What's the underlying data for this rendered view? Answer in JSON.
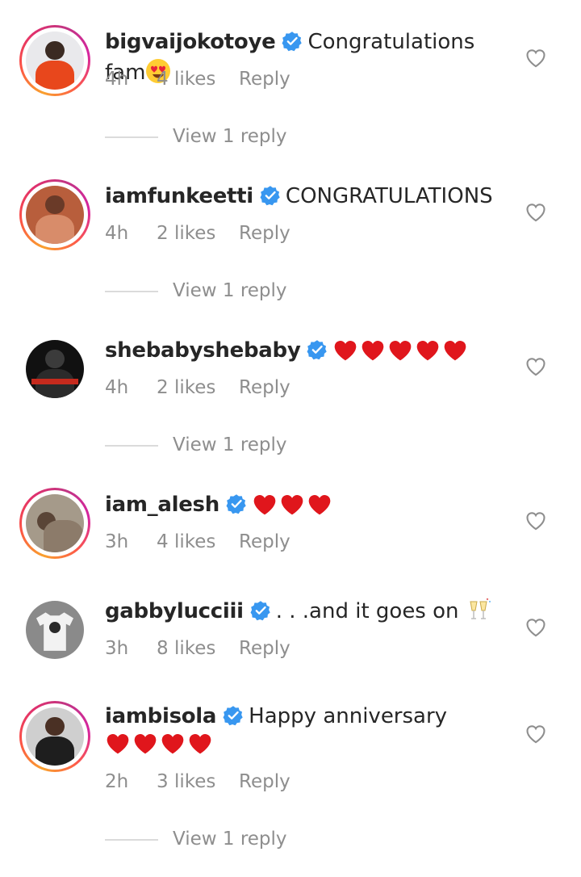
{
  "colors": {
    "verified": "#3897f0",
    "heart_red": "#e0161c",
    "meta_gray": "#8e8e8e"
  },
  "comments": [
    {
      "username": "bigvaijokotoye",
      "text": "Congratulations fam",
      "emoji": "heart-eyes-emoji",
      "time": "4h",
      "likes": "4 likes",
      "reply": "Reply",
      "view_replies": "View 1 reply"
    },
    {
      "username": "iamfunkeetti",
      "text": "CONGRATULATIONS",
      "time": "4h",
      "likes": "2 likes",
      "reply": "Reply",
      "view_replies": "View 1 reply"
    },
    {
      "username": "shebabyshebaby",
      "text": "",
      "hearts": 5,
      "time": "4h",
      "likes": "2 likes",
      "reply": "Reply",
      "view_replies": "View 1 reply"
    },
    {
      "username": "iam_alesh",
      "text": "",
      "hearts": 3,
      "time": "3h",
      "likes": "4 likes",
      "reply": "Reply"
    },
    {
      "username": "gabbylucciii",
      "text": ". . .and it goes on",
      "emoji": "champagne-glasses-emoji",
      "time": "3h",
      "likes": "8 likes",
      "reply": "Reply"
    },
    {
      "username": "iambisola",
      "text": "Happy anniversary",
      "hearts": 4,
      "time": "2h",
      "likes": "3 likes",
      "reply": "Reply",
      "view_replies": "View 1 reply"
    }
  ]
}
